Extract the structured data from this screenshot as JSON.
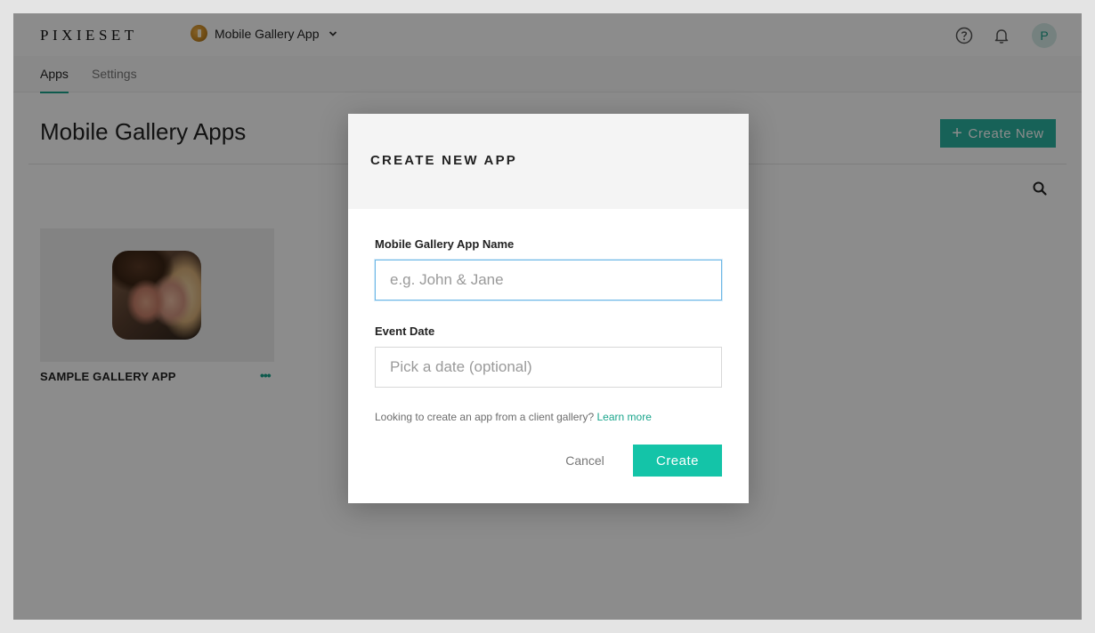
{
  "header": {
    "logo": "PIXIESET",
    "app_switcher": {
      "label": "Mobile Gallery App"
    }
  },
  "user": {
    "avatar_initial": "P"
  },
  "tabs": [
    {
      "label": "Apps",
      "active": true
    },
    {
      "label": "Settings",
      "active": false
    }
  ],
  "main": {
    "title": "Mobile Gallery Apps",
    "create_new_label": "Create New",
    "cards": [
      {
        "title": "SAMPLE GALLERY APP",
        "more_label": "•••"
      }
    ]
  },
  "modal": {
    "title": "CREATE NEW APP",
    "name_field": {
      "label": "Mobile Gallery App Name",
      "placeholder": "e.g. John & Jane",
      "value": ""
    },
    "date_field": {
      "label": "Event Date",
      "placeholder": "Pick a date (optional)",
      "value": ""
    },
    "helper_text": "Looking to create an app from a client gallery?",
    "helper_link": "Learn more",
    "cancel_label": "Cancel",
    "create_label": "Create"
  },
  "colors": {
    "accent": "#1aa58c",
    "create_button": "#14c4a8",
    "focus_border": "#6cb7e6"
  },
  "icons": {
    "help": "help-circle-icon",
    "notifications": "bell-icon",
    "search": "search-icon",
    "dropdown": "chevron-down-icon",
    "add": "plus-icon"
  }
}
